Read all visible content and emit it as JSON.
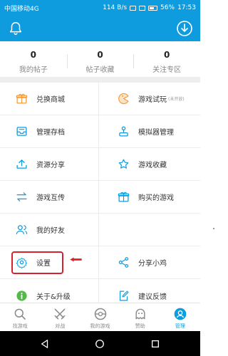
{
  "status_bar": {
    "carrier": "中国移动4G",
    "speed": "114 B/s",
    "battery": "56%",
    "time": "17:53"
  },
  "header": {
    "bell_icon": "bell-icon",
    "download_icon": "download-circle-icon"
  },
  "stats": [
    {
      "value": "0",
      "label": "我的帖子"
    },
    {
      "value": "0",
      "label": "帖子收藏"
    },
    {
      "value": "0",
      "label": "关注专区"
    }
  ],
  "menu": {
    "exchange_mall": "兑换商城",
    "game_trial": "游戏试玩",
    "game_trial_note": "(未开放)",
    "manage_saves": "管理存档",
    "emulator_manage": "模拟器管理",
    "resource_share": "资源分享",
    "game_favorites": "游戏收藏",
    "game_transfer": "游戏互传",
    "purchased_games": "购买的游戏",
    "my_friends": "我的好友",
    "settings": "设置",
    "share_xiaoji": "分享小鸡",
    "about_upgrade": "关于&升级",
    "feedback": "建议反馈"
  },
  "tabs": [
    {
      "label": "找游戏",
      "icon": "search-icon"
    },
    {
      "label": "对战",
      "icon": "crossed-swords-icon"
    },
    {
      "label": "我的游戏",
      "icon": "gamepad-icon"
    },
    {
      "label": "赞助",
      "icon": "ghost-icon"
    },
    {
      "label": "管理",
      "icon": "manage-icon"
    }
  ],
  "colors": {
    "brand_blue": "#0e9cdf",
    "accent_orange": "#f39c3a",
    "highlight_red": "#d8202f"
  }
}
